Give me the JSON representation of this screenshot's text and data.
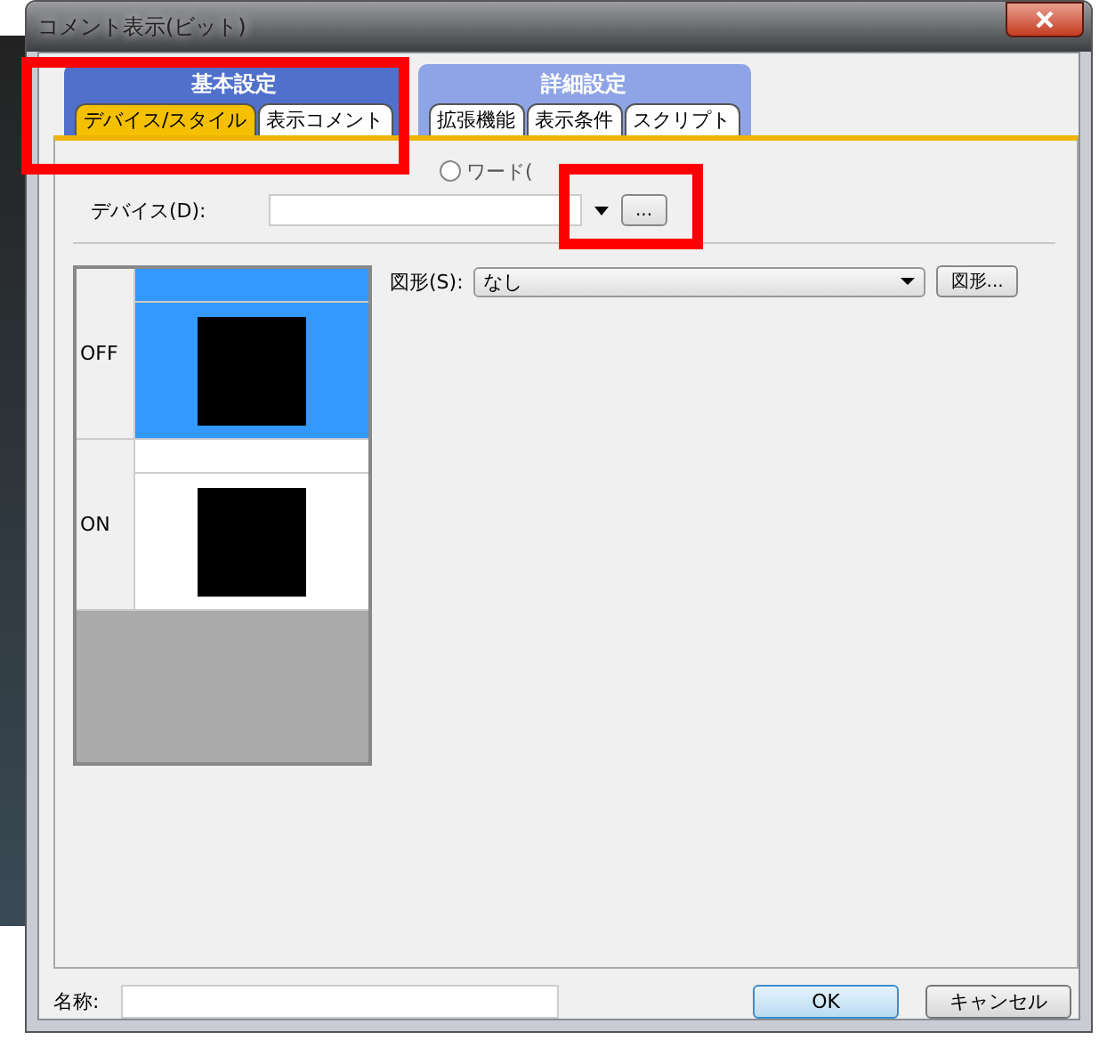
{
  "window": {
    "title": "コメント表示(ビット)"
  },
  "tab_groups": [
    {
      "label": "基本設定",
      "selected": true,
      "tabs": [
        {
          "label": "デバイス/スタイル",
          "selected": true
        },
        {
          "label": "表示コメント",
          "selected": false
        }
      ]
    },
    {
      "label": "詳細設定",
      "selected": false,
      "tabs": [
        {
          "label": "拡張機能",
          "selected": false
        },
        {
          "label": "表示条件",
          "selected": false
        },
        {
          "label": "スクリプト",
          "selected": false
        }
      ]
    }
  ],
  "display_type": {
    "options": [
      {
        "label": "ワード(",
        "selected": false
      }
    ]
  },
  "device": {
    "label": "デバイス(D):",
    "browse_button": "..."
  },
  "preview": {
    "states": [
      {
        "label": "OFF",
        "selected": true
      },
      {
        "label": "ON",
        "selected": false
      }
    ]
  },
  "shape": {
    "label": "図形(S):",
    "value": "なし",
    "button": "図形..."
  },
  "name": {
    "label": "名称:"
  },
  "buttons": [
    {
      "label": "OK",
      "kind": "default"
    },
    {
      "label": "キャンセル",
      "kind": "normal"
    }
  ]
}
